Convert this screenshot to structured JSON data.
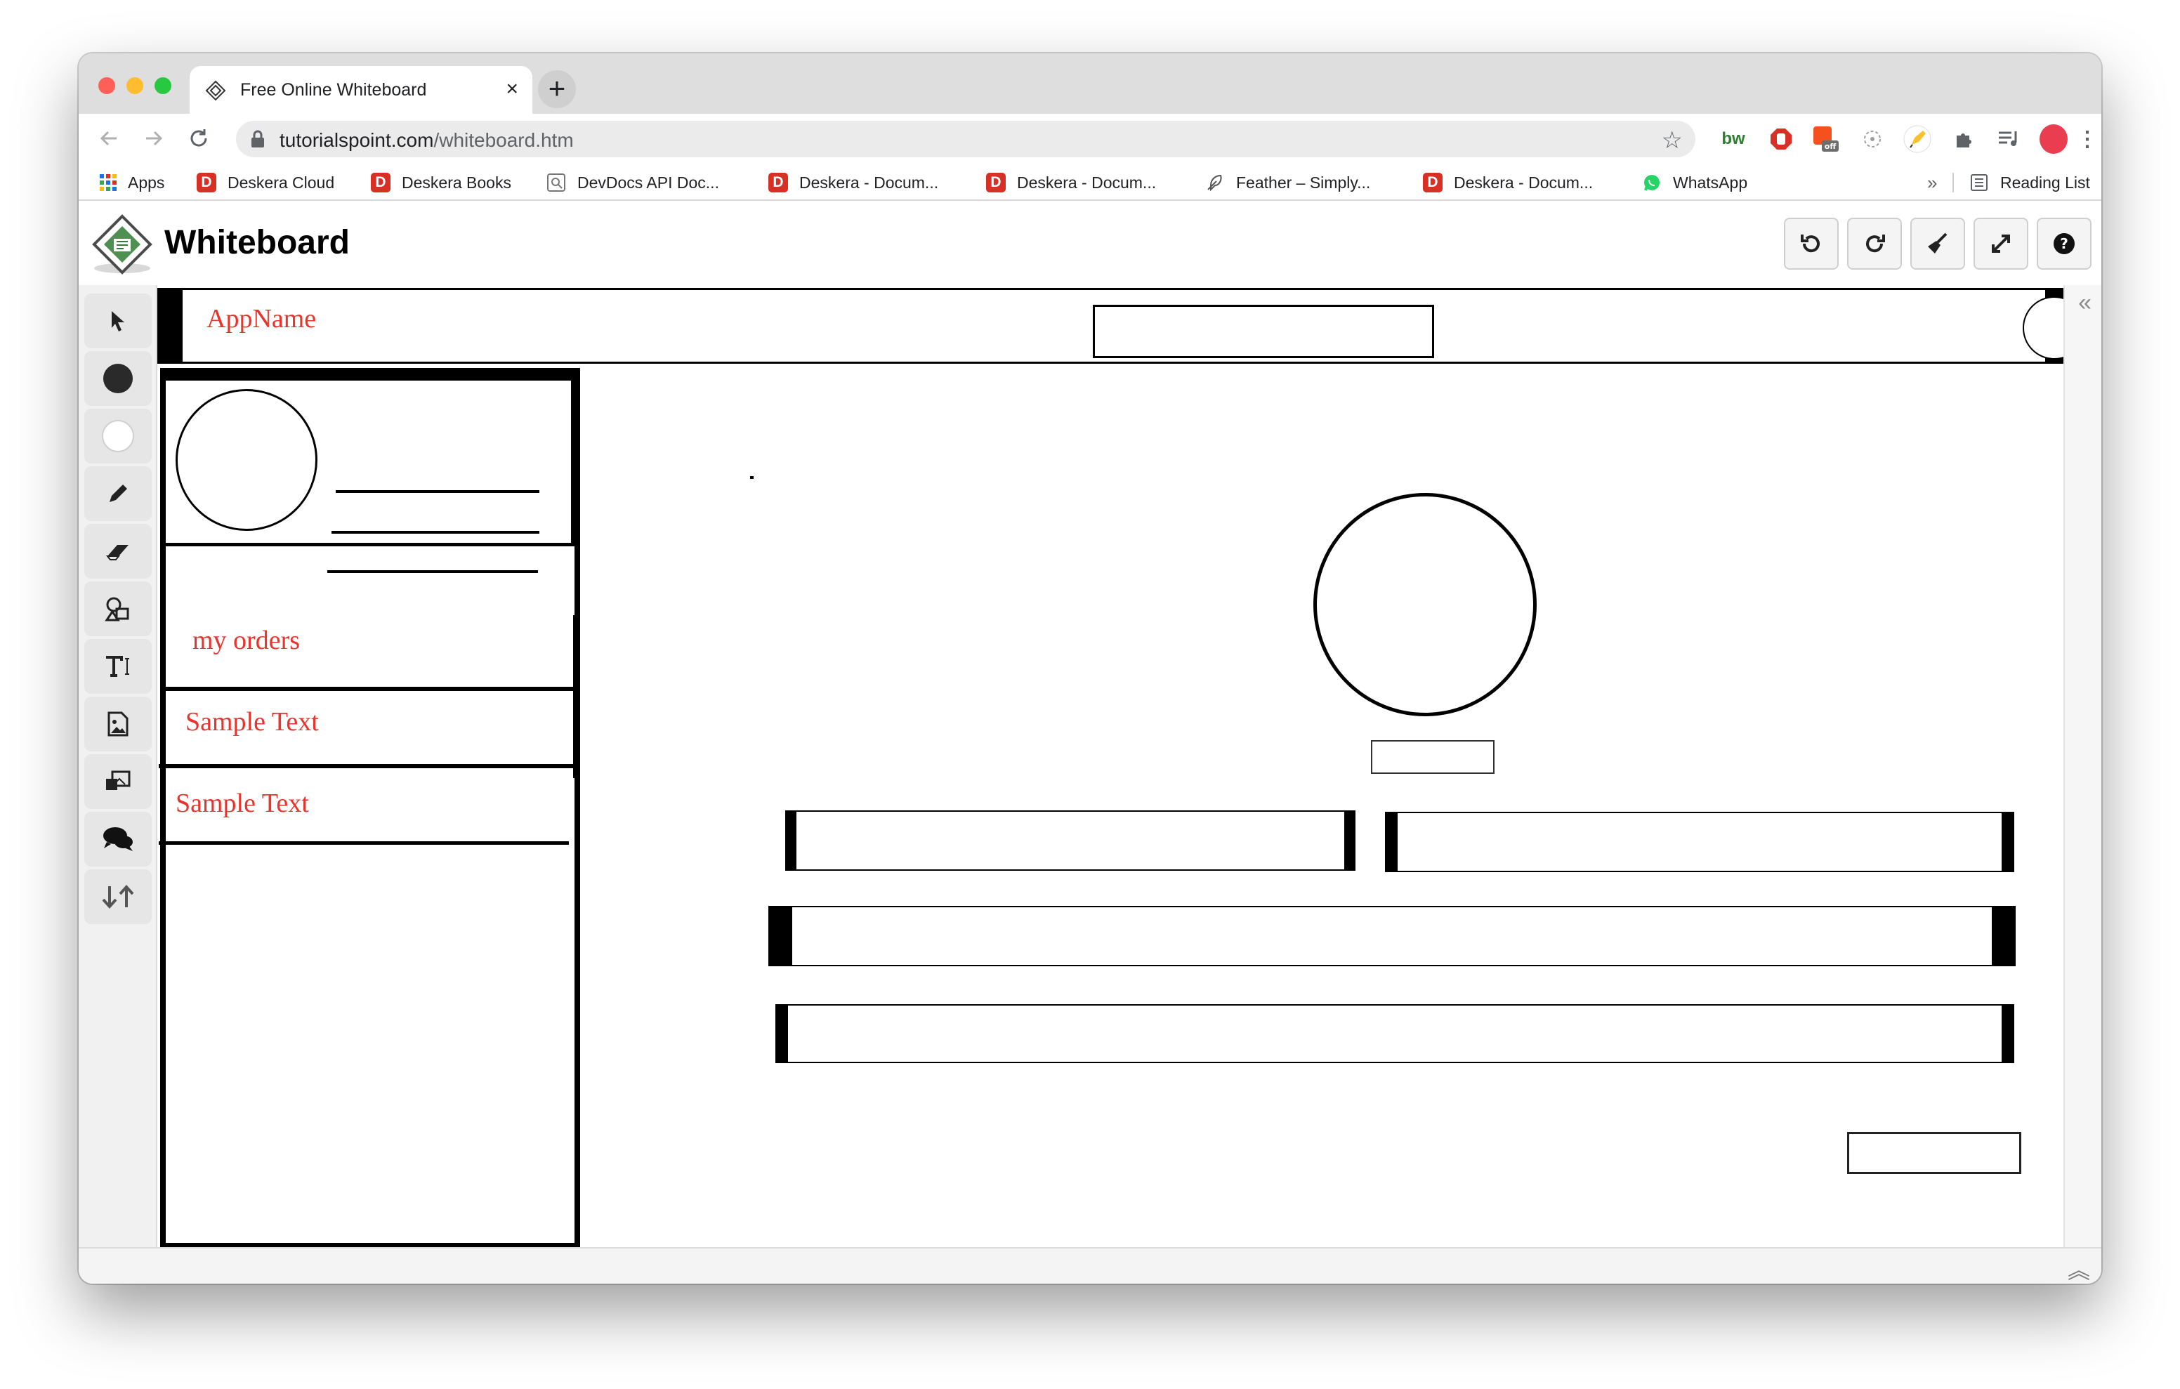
{
  "browser": {
    "tab_title": "Free Online Whiteboard",
    "tab_close": "×",
    "new_tab": "+",
    "url_domain": "tutorialspoint.com",
    "url_path": "/whiteboard.htm",
    "bookmarks": [
      {
        "label": "Apps",
        "icon": "apps-grid-icon"
      },
      {
        "label": "Deskera Cloud",
        "icon": "deskera-icon"
      },
      {
        "label": "Deskera Books",
        "icon": "deskera-icon"
      },
      {
        "label": "DevDocs API Doc...",
        "icon": "devdocs-icon"
      },
      {
        "label": "Deskera - Docum...",
        "icon": "deskera-icon"
      },
      {
        "label": "Deskera - Docum...",
        "icon": "deskera-icon"
      },
      {
        "label": "Feather – Simply...",
        "icon": "feather-icon"
      },
      {
        "label": "Deskera - Docum...",
        "icon": "deskera-icon"
      },
      {
        "label": "WhatsApp",
        "icon": "whatsapp-icon"
      }
    ],
    "bookmarks_overflow": "»",
    "reading_list": "Reading List",
    "deskera_letter": "D"
  },
  "app": {
    "title": "Whiteboard"
  },
  "wireframe": {
    "app_name": "AppName",
    "menu_item_1": "my orders",
    "menu_item_2": "Sample Text",
    "menu_item_3": "Sample Text"
  },
  "colors": {
    "wireframe_text": "#e8342c",
    "profile_dot": "#ea3d4f"
  }
}
